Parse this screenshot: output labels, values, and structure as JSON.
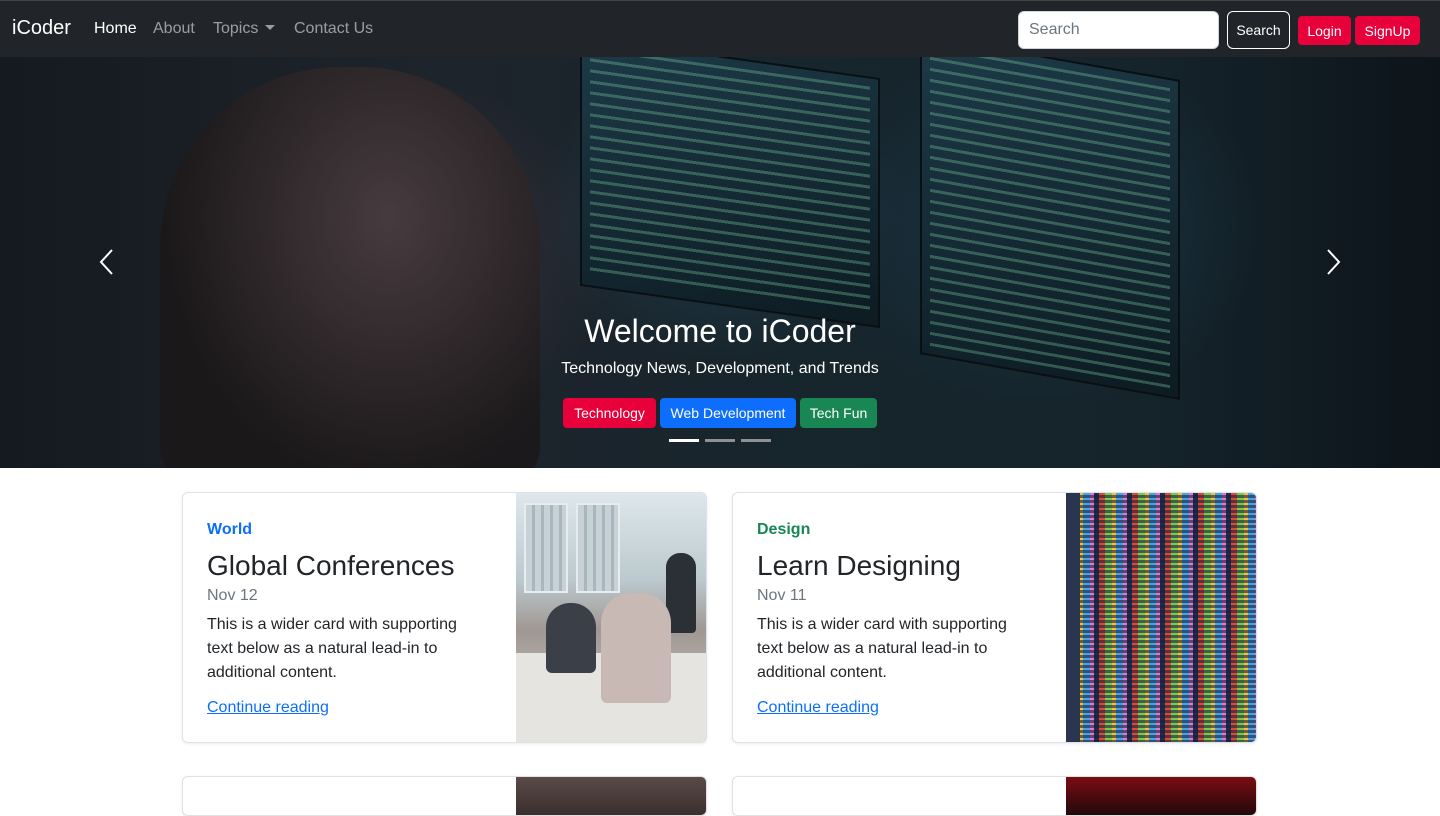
{
  "navbar": {
    "brand": "iCoder",
    "links": [
      {
        "label": "Home",
        "active": true
      },
      {
        "label": "About",
        "active": false
      },
      {
        "label": "Topics",
        "active": false,
        "dropdown": true
      },
      {
        "label": "Contact Us",
        "active": false
      }
    ],
    "search": {
      "placeholder": "Search",
      "value": "",
      "button_label": "Search"
    },
    "login_label": "Login",
    "signup_label": "SignUp"
  },
  "hero": {
    "title": "Welcome to iCoder",
    "subtitle": "Technology News, Development, and Trends",
    "buttons": [
      {
        "label": "Technology",
        "color": "#e8003a"
      },
      {
        "label": "Web Development",
        "color": "#0d6efd"
      },
      {
        "label": "Tech Fun",
        "color": "#198754"
      }
    ],
    "indicators": 3,
    "active_slide": 1
  },
  "cards": [
    {
      "category": "World",
      "category_color": "#0d6efd",
      "title": "Global Conferences",
      "date": "Nov 12",
      "text": "This is a wider card with supporting text below as a natural lead-in to additional content.",
      "link": "Continue reading"
    },
    {
      "category": "Design",
      "category_color": "#198754",
      "title": "Learn Designing",
      "date": "Nov 11",
      "text": "This is a wider card with supporting text below as a natural lead-in to additional content.",
      "link": "Continue reading"
    }
  ],
  "colors": {
    "navbar_bg": "#212529",
    "accent_red": "#e8003a",
    "link_blue": "#0d6efd",
    "design_green": "#198754"
  }
}
